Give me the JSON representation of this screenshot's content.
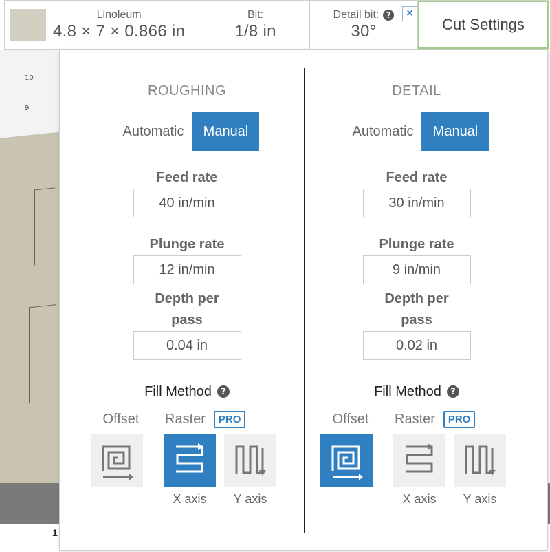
{
  "canvas": {
    "ruler_labels": [
      "10",
      "9"
    ],
    "bottom_mark": "1"
  },
  "toolbar": {
    "material": {
      "name": "Linoleum",
      "size": "4.8 × 7 × 0.866 in",
      "swatch_color": "#d4d0c1"
    },
    "bit": {
      "label": "Bit:",
      "value": "1/8 in"
    },
    "detail_bit": {
      "label": "Detail bit:",
      "value": "30°",
      "help": "?",
      "close": "×"
    },
    "cut_settings_label": "Cut Settings"
  },
  "roughing": {
    "title": "ROUGHING",
    "mode": {
      "automatic": "Automatic",
      "manual": "Manual",
      "selected": "Manual"
    },
    "feed_rate": {
      "label": "Feed rate",
      "value": "40 in/min"
    },
    "plunge_rate": {
      "label": "Plunge rate",
      "value": "12 in/min"
    },
    "depth_per_pass": {
      "label": "Depth per pass",
      "value": "0.04 in"
    },
    "fill_method": {
      "label": "Fill Method",
      "help": "?",
      "offset_label": "Offset",
      "raster_label": "Raster",
      "pro_badge": "PRO",
      "x_axis_label": "X axis",
      "y_axis_label": "Y axis",
      "selected": "X axis"
    }
  },
  "detail": {
    "title": "DETAIL",
    "mode": {
      "automatic": "Automatic",
      "manual": "Manual",
      "selected": "Manual"
    },
    "feed_rate": {
      "label": "Feed rate",
      "value": "30 in/min"
    },
    "plunge_rate": {
      "label": "Plunge rate",
      "value": "9 in/min"
    },
    "depth_per_pass": {
      "label": "Depth per pass",
      "value": "0.02 in"
    },
    "fill_method": {
      "label": "Fill Method",
      "help": "?",
      "offset_label": "Offset",
      "raster_label": "Raster",
      "pro_badge": "PRO",
      "x_axis_label": "X axis",
      "y_axis_label": "Y axis",
      "selected": "Offset"
    }
  },
  "colors": {
    "accent": "#2f7fc1",
    "cut_settings_border": "#9bd28a",
    "tile_bg": "#efefef"
  }
}
